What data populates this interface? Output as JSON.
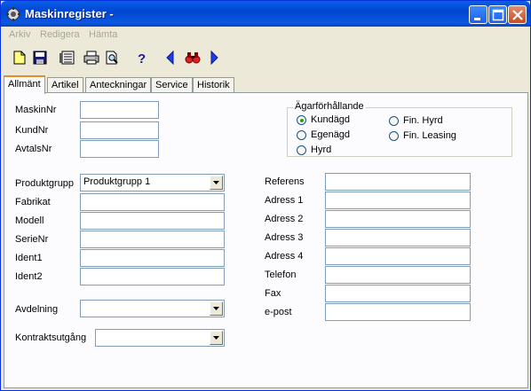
{
  "window": {
    "title": "Maskinregister -"
  },
  "titlebar_buttons": [
    "minimize-icon",
    "maximize-icon",
    "close-icon"
  ],
  "menu": {
    "items": [
      "Arkiv",
      "Redigera",
      "Hämta"
    ]
  },
  "toolbar": {
    "buttons": [
      "new-document-icon",
      "save-icon",
      "list-icon",
      "print-icon",
      "print-preview-icon",
      "help-icon",
      "previous-icon",
      "find-icon",
      "next-icon"
    ]
  },
  "tabs": [
    "Allmänt",
    "Artikel",
    "Anteckningar",
    "Service",
    "Historik"
  ],
  "active_tab": "Allmänt",
  "form": {
    "maskinnr": {
      "label": "MaskinNr",
      "value": ""
    },
    "kundnr": {
      "label": "KundNr",
      "value": ""
    },
    "avtalsnr": {
      "label": "AvtalsNr",
      "value": ""
    },
    "produktgrupp": {
      "label": "Produktgrupp",
      "value": "Produktgrupp 1"
    },
    "fabrikat": {
      "label": "Fabrikat",
      "value": ""
    },
    "modell": {
      "label": "Modell",
      "value": ""
    },
    "serienr": {
      "label": "SerieNr",
      "value": ""
    },
    "ident1": {
      "label": "Ident1",
      "value": ""
    },
    "ident2": {
      "label": "Ident2",
      "value": ""
    },
    "avdelning": {
      "label": "Avdelning",
      "value": ""
    },
    "kontraktsutgang": {
      "label": "Kontraktsutgång",
      "value": ""
    },
    "referens": {
      "label": "Referens",
      "value": ""
    },
    "adress1": {
      "label": "Adress 1",
      "value": ""
    },
    "adress2": {
      "label": "Adress 2",
      "value": ""
    },
    "adress3": {
      "label": "Adress 3",
      "value": ""
    },
    "adress4": {
      "label": "Adress 4",
      "value": ""
    },
    "telefon": {
      "label": "Telefon",
      "value": ""
    },
    "fax": {
      "label": "Fax",
      "value": ""
    },
    "epost": {
      "label": "e-post",
      "value": ""
    }
  },
  "ownership": {
    "title": "Ägarförhållande",
    "options": [
      "Kundägd",
      "Egenägd",
      "Hyrd",
      "Fin. Hyrd",
      "Fin. Leasing"
    ],
    "selected": "Kundägd"
  }
}
